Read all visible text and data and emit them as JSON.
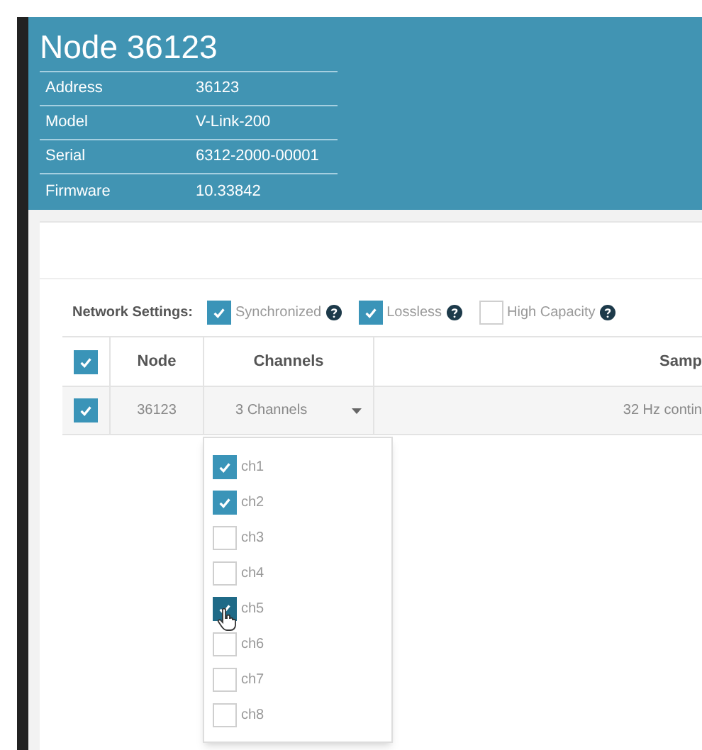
{
  "header": {
    "title": "Node 36123",
    "properties": [
      {
        "label": "Address",
        "value": "36123"
      },
      {
        "label": "Model",
        "value": "V-Link-200"
      },
      {
        "label": "Serial",
        "value": "6312-2000-00001"
      },
      {
        "label": "Firmware",
        "value": "10.33842"
      }
    ]
  },
  "network_settings": {
    "label": "Network Settings:",
    "options": [
      {
        "label": "Synchronized",
        "checked": true
      },
      {
        "label": "Lossless",
        "checked": true
      },
      {
        "label": "High Capacity",
        "checked": false
      }
    ]
  },
  "table": {
    "select_all_checked": true,
    "columns": [
      "Node",
      "Channels",
      "Samp"
    ],
    "rows": [
      {
        "checked": true,
        "node": "36123",
        "channels": "3 Channels",
        "column_3": "32 Hz contin"
      }
    ]
  },
  "channel_dropdown": {
    "options": [
      {
        "label": "ch1",
        "checked": true,
        "hovered": false
      },
      {
        "label": "ch2",
        "checked": true,
        "hovered": false
      },
      {
        "label": "ch3",
        "checked": false,
        "hovered": false
      },
      {
        "label": "ch4",
        "checked": false,
        "hovered": false
      },
      {
        "label": "ch5",
        "checked": true,
        "hovered": true
      },
      {
        "label": "ch6",
        "checked": false,
        "hovered": false
      },
      {
        "label": "ch7",
        "checked": false,
        "hovered": false
      },
      {
        "label": "ch8",
        "checked": false,
        "hovered": false
      }
    ]
  }
}
